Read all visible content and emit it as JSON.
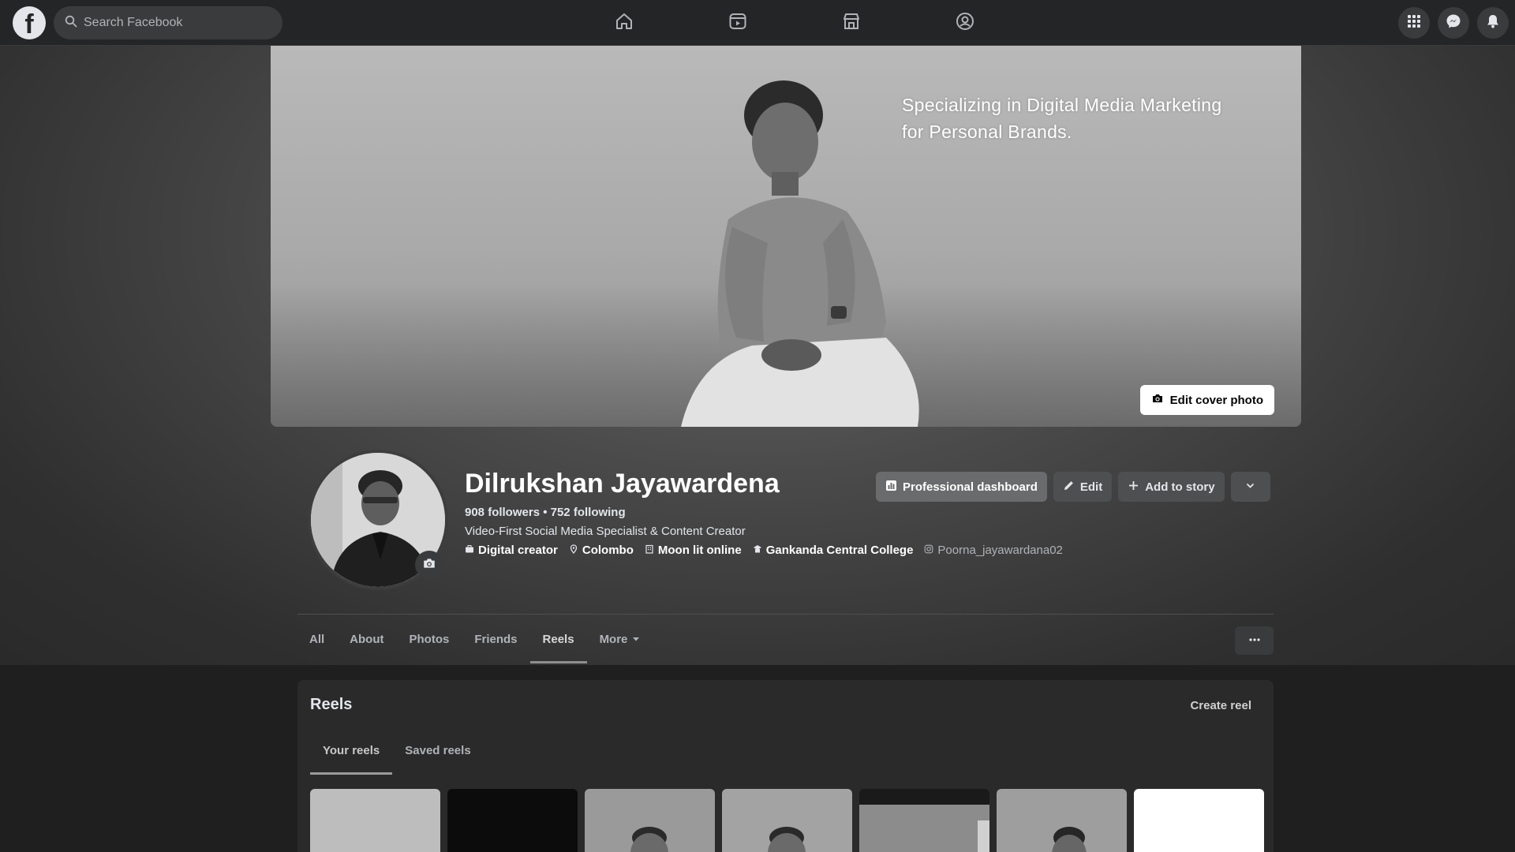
{
  "topbar": {
    "logo_letter": "f",
    "search": {
      "placeholder": "Search Facebook"
    },
    "nav_icons": [
      "home-icon",
      "video-icon",
      "marketplace-icon",
      "groups-icon"
    ],
    "right_icons": [
      "menu-grid-icon",
      "messenger-icon",
      "notifications-icon"
    ]
  },
  "cover": {
    "tagline_line1": "Specializing in Digital Media Marketing",
    "tagline_line2": "for Personal Brands.",
    "edit_button": "Edit cover photo"
  },
  "profile": {
    "name": "Dilrukshan Jayawardena",
    "followers_line": "908 followers • 752 following",
    "bio": "Video-First Social Media Specialist & Content Creator",
    "details": {
      "category": "Digital creator",
      "location": "Colombo",
      "work": "Moon lit online",
      "education": "Gankanda Central College",
      "instagram": "Poorna_jayawardana02"
    }
  },
  "actions": {
    "dashboard": "Professional dashboard",
    "edit": "Edit",
    "add_story": "Add to story"
  },
  "tabs": {
    "all": "All",
    "about": "About",
    "photos": "Photos",
    "friends": "Friends",
    "reels": "Reels",
    "more": "More",
    "active": "Reels"
  },
  "reels": {
    "title": "Reels",
    "create": "Create reel",
    "tab_yours": "Your reels",
    "tab_saved": "Saved reels",
    "active_tab": "Your reels"
  },
  "colors": {
    "topbar": "#242526",
    "surface": "#3a3b3c",
    "text": "#e4e6eb",
    "muted": "#b0b3b8"
  }
}
